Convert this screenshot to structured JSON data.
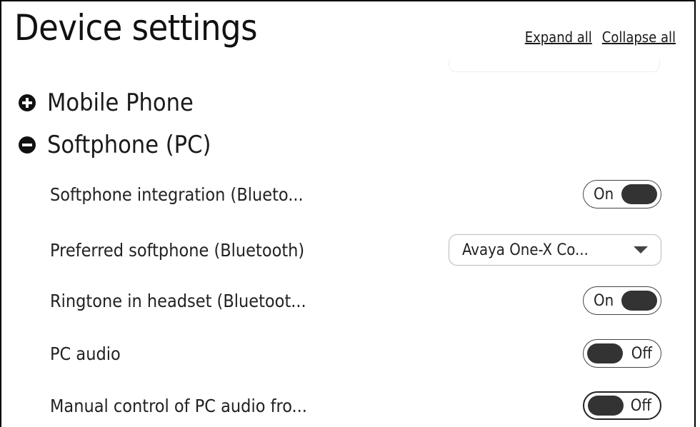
{
  "title": "Device settings",
  "header": {
    "expand_all": "Expand all",
    "collapse_all": "Collapse all"
  },
  "sections": [
    {
      "label": "Mobile Phone",
      "expanded": false,
      "icon": "plus-circle-icon"
    },
    {
      "label": "Softphone (PC)",
      "expanded": true,
      "icon": "minus-circle-icon"
    }
  ],
  "settings": [
    {
      "label": "Softphone integration (Blueto...",
      "control": "toggle",
      "state": "On"
    },
    {
      "label": "Preferred softphone (Bluetooth)",
      "control": "select",
      "value": "Avaya One-X Co..."
    },
    {
      "label": "Ringtone in headset (Bluetoot...",
      "control": "toggle",
      "state": "On"
    },
    {
      "label": "PC audio",
      "control": "toggle",
      "state": "Off"
    },
    {
      "label": "Manual control of PC audio fro...",
      "control": "toggle",
      "state": "Off"
    }
  ],
  "colors": {
    "text": "#1a1a1a",
    "knob": "#333333",
    "border": "#444444"
  }
}
